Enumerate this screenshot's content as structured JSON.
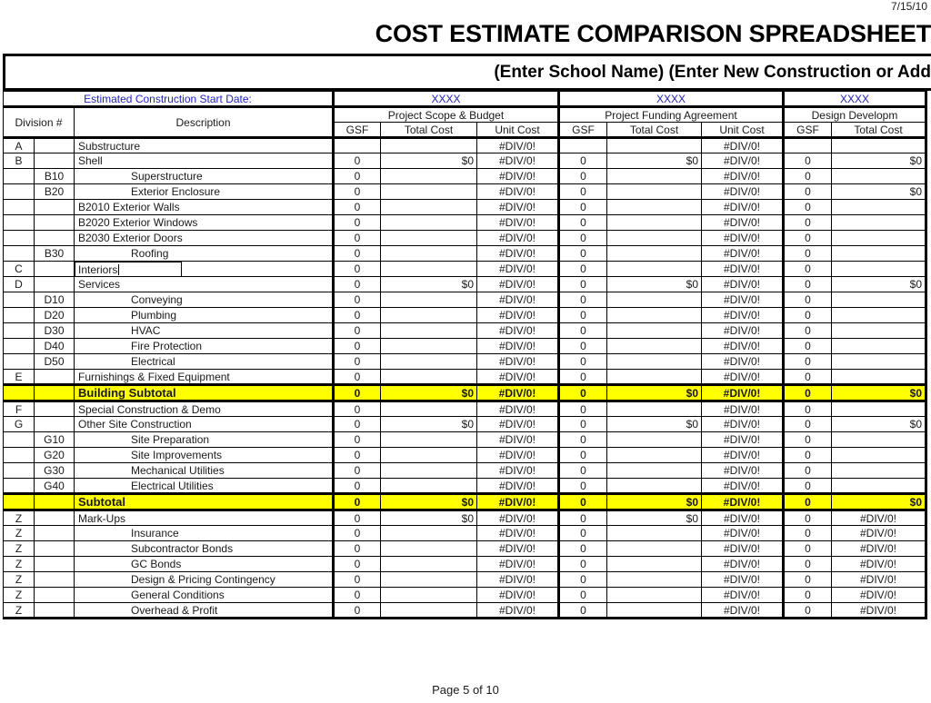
{
  "header": {
    "date_stamp": "7/15/10",
    "title": "COST ESTIMATE COMPARISON SPREADSHEET",
    "subtitle": "(Enter School Name) (Enter New Construction or Add"
  },
  "table": {
    "start_date_label": "Estimated Construction Start Date:",
    "start_date_values": [
      "XXXX",
      "XXXX",
      "XXXX"
    ],
    "groups": [
      "Project Scope & Budget",
      "Project Funding Agreement",
      "Design Developm"
    ],
    "division_header": "Division #",
    "description_header": "Description",
    "sub_headers": [
      "GSF",
      "Total Cost",
      "Unit Cost"
    ],
    "editing_cell": {
      "text": "Interiors",
      "row_index": 8
    },
    "rows": [
      {
        "div": "A",
        "code": "",
        "desc": "Substructure",
        "indent": 1,
        "style": "normal",
        "cells": [
          "",
          "",
          "#DIV/0!",
          "",
          "",
          "#DIV/0!",
          "",
          ""
        ]
      },
      {
        "div": "B",
        "code": "",
        "desc": "Shell",
        "indent": 1,
        "style": "normal",
        "cells": [
          "0",
          "$0",
          "#DIV/0!",
          "0",
          "$0",
          "#DIV/0!",
          "0",
          "$0"
        ]
      },
      {
        "div": "",
        "code": "B10",
        "desc": "Superstructure",
        "indent": 2,
        "style": "normal",
        "cells": [
          "0",
          "",
          "#DIV/0!",
          "0",
          "",
          "#DIV/0!",
          "0",
          ""
        ]
      },
      {
        "div": "",
        "code": "B20",
        "desc": "Exterior Enclosure",
        "indent": 2,
        "style": "greyline",
        "cells": [
          "0",
          "",
          "#DIV/0!",
          "0",
          "",
          "#DIV/0!",
          "0",
          "$0"
        ]
      },
      {
        "div": "",
        "code": "",
        "desc": "B2010    Exterior Walls",
        "indent": 3,
        "style": "normal",
        "cells": [
          "0",
          "",
          "#DIV/0!",
          "0",
          "",
          "#DIV/0!",
          "0",
          ""
        ]
      },
      {
        "div": "",
        "code": "",
        "desc": "B2020    Exterior Windows",
        "indent": 3,
        "style": "normal",
        "cells": [
          "0",
          "",
          "#DIV/0!",
          "0",
          "",
          "#DIV/0!",
          "0",
          ""
        ]
      },
      {
        "div": "",
        "code": "",
        "desc": "B2030    Exterior Doors",
        "indent": 3,
        "style": "normal",
        "cells": [
          "0",
          "",
          "#DIV/0!",
          "0",
          "",
          "#DIV/0!",
          "0",
          ""
        ]
      },
      {
        "div": "",
        "code": "B30",
        "desc": "Roofing",
        "indent": 2,
        "style": "normal",
        "cells": [
          "0",
          "",
          "#DIV/0!",
          "0",
          "",
          "#DIV/0!",
          "0",
          ""
        ]
      },
      {
        "div": "C",
        "code": "",
        "desc": "Interiors",
        "indent": 1,
        "style": "editing",
        "cells": [
          "0",
          "",
          "#DIV/0!",
          "0",
          "",
          "#DIV/0!",
          "0",
          ""
        ]
      },
      {
        "div": "D",
        "code": "",
        "desc": "Services",
        "indent": 1,
        "style": "normal",
        "cells": [
          "0",
          "$0",
          "#DIV/0!",
          "0",
          "$0",
          "#DIV/0!",
          "0",
          "$0"
        ]
      },
      {
        "div": "",
        "code": "D10",
        "desc": "Conveying",
        "indent": 2,
        "style": "normal",
        "cells": [
          "0",
          "",
          "#DIV/0!",
          "0",
          "",
          "#DIV/0!",
          "0",
          ""
        ]
      },
      {
        "div": "",
        "code": "D20",
        "desc": "Plumbing",
        "indent": 2,
        "style": "normal",
        "cells": [
          "0",
          "",
          "#DIV/0!",
          "0",
          "",
          "#DIV/0!",
          "0",
          ""
        ]
      },
      {
        "div": "",
        "code": "D30",
        "desc": "HVAC",
        "indent": 2,
        "style": "normal",
        "cells": [
          "0",
          "",
          "#DIV/0!",
          "0",
          "",
          "#DIV/0!",
          "0",
          ""
        ]
      },
      {
        "div": "",
        "code": "D40",
        "desc": "Fire Protection",
        "indent": 2,
        "style": "normal",
        "cells": [
          "0",
          "",
          "#DIV/0!",
          "0",
          "",
          "#DIV/0!",
          "0",
          ""
        ]
      },
      {
        "div": "",
        "code": "D50",
        "desc": "Electrical",
        "indent": 2,
        "style": "normal",
        "cells": [
          "0",
          "",
          "#DIV/0!",
          "0",
          "",
          "#DIV/0!",
          "0",
          ""
        ]
      },
      {
        "div": "E",
        "code": "",
        "desc": "Furnishings & Fixed Equipment",
        "indent": 1,
        "style": "normal",
        "cells": [
          "0",
          "",
          "#DIV/0!",
          "0",
          "",
          "#DIV/0!",
          "0",
          ""
        ]
      },
      {
        "div": "",
        "code": "",
        "desc": "Building Subtotal",
        "indent": 1,
        "style": "yellow",
        "cells": [
          "0",
          "$0",
          "#DIV/0!",
          "0",
          "$0",
          "#DIV/0!",
          "0",
          "$0"
        ]
      },
      {
        "div": "F",
        "code": "",
        "desc": "Special Construction & Demo",
        "indent": 1,
        "style": "normal",
        "cells": [
          "0",
          "",
          "#DIV/0!",
          "0",
          "",
          "#DIV/0!",
          "0",
          ""
        ]
      },
      {
        "div": "G",
        "code": "",
        "desc": "Other Site Construction",
        "indent": 1,
        "style": "normal",
        "cells": [
          "0",
          "$0",
          "#DIV/0!",
          "0",
          "$0",
          "#DIV/0!",
          "0",
          "$0"
        ]
      },
      {
        "div": "",
        "code": "G10",
        "desc": "Site Preparation",
        "indent": 2,
        "style": "normal",
        "cells": [
          "0",
          "",
          "#DIV/0!",
          "0",
          "",
          "#DIV/0!",
          "0",
          ""
        ]
      },
      {
        "div": "",
        "code": "G20",
        "desc": "Site Improvements",
        "indent": 2,
        "style": "normal",
        "cells": [
          "0",
          "",
          "#DIV/0!",
          "0",
          "",
          "#DIV/0!",
          "0",
          ""
        ]
      },
      {
        "div": "",
        "code": "G30",
        "desc": "Mechanical Utilities",
        "indent": 2,
        "style": "normal",
        "cells": [
          "0",
          "",
          "#DIV/0!",
          "0",
          "",
          "#DIV/0!",
          "0",
          ""
        ]
      },
      {
        "div": "",
        "code": "G40",
        "desc": "Electrical Utilities",
        "indent": 2,
        "style": "normal",
        "cells": [
          "0",
          "",
          "#DIV/0!",
          "0",
          "",
          "#DIV/0!",
          "0",
          ""
        ]
      },
      {
        "div": "",
        "code": "",
        "desc": "Subtotal",
        "indent": 1,
        "style": "yellow",
        "cells": [
          "0",
          "$0",
          "#DIV/0!",
          "0",
          "$0",
          "#DIV/0!",
          "0",
          "$0"
        ]
      },
      {
        "div": "Z",
        "code": "",
        "desc": "Mark-Ups",
        "indent": 1,
        "style": "normal",
        "cells": [
          "0",
          "$0",
          "#DIV/0!",
          "0",
          "$0",
          "#DIV/0!",
          "0",
          "#DIV/0!"
        ]
      },
      {
        "div": "Z",
        "code": "",
        "desc": "Insurance",
        "indent": 2,
        "style": "normal",
        "cells": [
          "0",
          "",
          "#DIV/0!",
          "0",
          "",
          "#DIV/0!",
          "0",
          "#DIV/0!"
        ]
      },
      {
        "div": "Z",
        "code": "",
        "desc": "Subcontractor Bonds",
        "indent": 2,
        "style": "normal",
        "cells": [
          "0",
          "",
          "#DIV/0!",
          "0",
          "",
          "#DIV/0!",
          "0",
          "#DIV/0!"
        ]
      },
      {
        "div": "Z",
        "code": "",
        "desc": "GC Bonds",
        "indent": 2,
        "style": "normal",
        "cells": [
          "0",
          "",
          "#DIV/0!",
          "0",
          "",
          "#DIV/0!",
          "0",
          "#DIV/0!"
        ]
      },
      {
        "div": "Z",
        "code": "",
        "desc": "Design & Pricing Contingency",
        "indent": 2,
        "style": "normal",
        "cells": [
          "0",
          "",
          "#DIV/0!",
          "0",
          "",
          "#DIV/0!",
          "0",
          "#DIV/0!"
        ]
      },
      {
        "div": "Z",
        "code": "",
        "desc": "General Conditions",
        "indent": 2,
        "style": "normal",
        "cells": [
          "0",
          "",
          "#DIV/0!",
          "0",
          "",
          "#DIV/0!",
          "0",
          "#DIV/0!"
        ]
      },
      {
        "div": "Z",
        "code": "",
        "desc": "Overhead & Profit",
        "indent": 2,
        "style": "normal",
        "cells": [
          "0",
          "",
          "#DIV/0!",
          "0",
          "",
          "#DIV/0!",
          "0",
          "#DIV/0!"
        ]
      }
    ]
  },
  "footer": {
    "page_label": "Page 5 of 10"
  },
  "colors": {
    "subtotal_highlight": "#ffff00",
    "header_blue": "#2222bb",
    "text": "#1a1a1a"
  }
}
